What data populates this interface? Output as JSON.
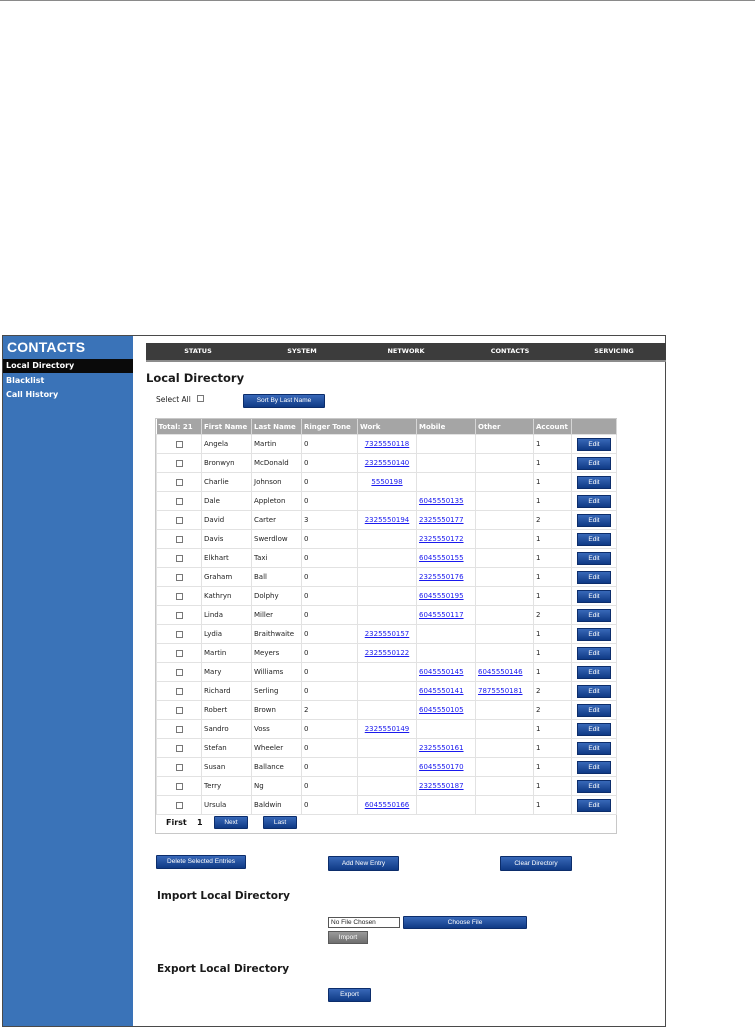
{
  "sidebar": {
    "title": "CONTACTS",
    "items": [
      {
        "label": "Local Directory",
        "active": true
      },
      {
        "label": "Blacklist",
        "active": false
      },
      {
        "label": "Call History",
        "active": false
      }
    ]
  },
  "nav": {
    "items": [
      "STATUS",
      "SYSTEM",
      "NETWORK",
      "CONTACTS",
      "SERVICING"
    ]
  },
  "page": {
    "title": "Local Directory",
    "select_all_label": "Select All",
    "sort_button": "Sort By Last Name"
  },
  "table": {
    "columns": [
      "Total: 21",
      "First Name",
      "Last Name",
      "Ringer Tone",
      "Work",
      "Mobile",
      "Other",
      "Account",
      ""
    ],
    "edit_label": "Edit",
    "rows": [
      {
        "first": "Angela",
        "last": "Martin",
        "tone": "0",
        "work": "7325550118",
        "mobile": "",
        "other": "",
        "account": "1"
      },
      {
        "first": "Bronwyn",
        "last": "McDonald",
        "tone": "0",
        "work": "2325550140",
        "mobile": "",
        "other": "",
        "account": "1"
      },
      {
        "first": "Charlie",
        "last": "Johnson",
        "tone": "0",
        "work": "5550198",
        "mobile": "",
        "other": "",
        "account": "1"
      },
      {
        "first": "Dale",
        "last": "Appleton",
        "tone": "0",
        "work": "",
        "mobile": "6045550135",
        "other": "",
        "account": "1"
      },
      {
        "first": "David",
        "last": "Carter",
        "tone": "3",
        "work": "2325550194",
        "mobile": "2325550177",
        "other": "",
        "account": "2"
      },
      {
        "first": "Davis",
        "last": "Swerdlow",
        "tone": "0",
        "work": "",
        "mobile": "2325550172",
        "other": "",
        "account": "1"
      },
      {
        "first": "Elkhart",
        "last": "Taxi",
        "tone": "0",
        "work": "",
        "mobile": "6045550155",
        "other": "",
        "account": "1"
      },
      {
        "first": "Graham",
        "last": "Ball",
        "tone": "0",
        "work": "",
        "mobile": "2325550176",
        "other": "",
        "account": "1"
      },
      {
        "first": "Kathryn",
        "last": "Dolphy",
        "tone": "0",
        "work": "",
        "mobile": "6045550195",
        "other": "",
        "account": "1"
      },
      {
        "first": "Linda",
        "last": "Miller",
        "tone": "0",
        "work": "",
        "mobile": "6045550117",
        "other": "",
        "account": "2"
      },
      {
        "first": "Lydia",
        "last": "Braithwaite",
        "tone": "0",
        "work": "2325550157",
        "mobile": "",
        "other": "",
        "account": "1"
      },
      {
        "first": "Martin",
        "last": "Meyers",
        "tone": "0",
        "work": "2325550122",
        "mobile": "",
        "other": "",
        "account": "1"
      },
      {
        "first": "Mary",
        "last": "Williams",
        "tone": "0",
        "work": "",
        "mobile": "6045550145",
        "other": "6045550146",
        "account": "1"
      },
      {
        "first": "Richard",
        "last": "Serling",
        "tone": "0",
        "work": "",
        "mobile": "6045550141",
        "other": "7875550181",
        "account": "2"
      },
      {
        "first": "Robert",
        "last": "Brown",
        "tone": "2",
        "work": "",
        "mobile": "6045550105",
        "other": "",
        "account": "2"
      },
      {
        "first": "Sandro",
        "last": "Voss",
        "tone": "0",
        "work": "2325550149",
        "mobile": "",
        "other": "",
        "account": "1"
      },
      {
        "first": "Stefan",
        "last": "Wheeler",
        "tone": "0",
        "work": "",
        "mobile": "2325550161",
        "other": "",
        "account": "1"
      },
      {
        "first": "Susan",
        "last": "Ballance",
        "tone": "0",
        "work": "",
        "mobile": "6045550170",
        "other": "",
        "account": "1"
      },
      {
        "first": "Terry",
        "last": "Ng",
        "tone": "0",
        "work": "",
        "mobile": "2325550187",
        "other": "",
        "account": "1"
      },
      {
        "first": "Ursula",
        "last": "Baldwin",
        "tone": "0",
        "work": "6045550166",
        "mobile": "",
        "other": "",
        "account": "1"
      }
    ]
  },
  "pager": {
    "first_label": "First",
    "page_number": "1",
    "next_label": "Next",
    "last_label": "Last"
  },
  "actions": {
    "delete_selected": "Delete Selected Entries",
    "add_new": "Add New Entry",
    "clear_directory": "Clear Directory"
  },
  "import": {
    "title": "Import Local Directory",
    "file_status": "No File Chosen",
    "choose_file": "Choose File",
    "import_button": "Import"
  },
  "export": {
    "title": "Export Local Directory",
    "export_button": "Export"
  },
  "colors": {
    "sidebar_bg": "#3a73b8",
    "button_blue": "#0f3a85",
    "nav_bg": "#3c3c3c",
    "header_gray": "#a5a5a5",
    "link_blue": "#1a1aee"
  }
}
